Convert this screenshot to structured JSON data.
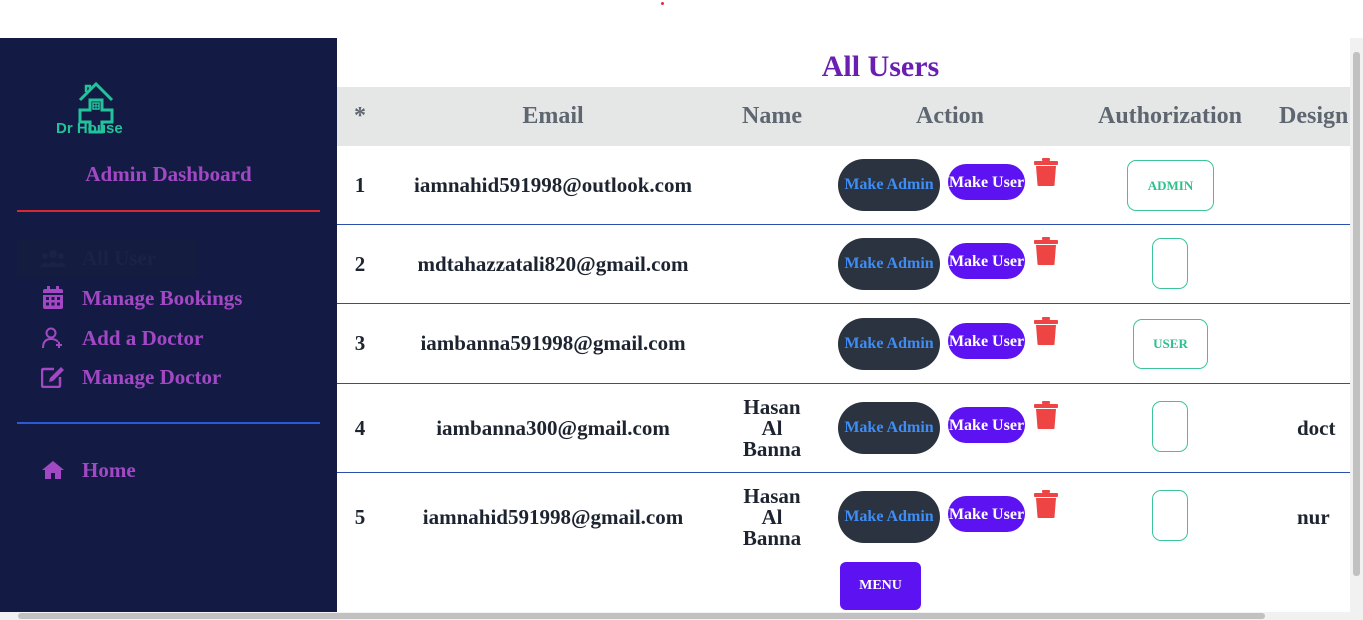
{
  "sidebar": {
    "logo_text": "Dr House",
    "dashboard_title": "Admin Dashboard",
    "nav": [
      {
        "label": "All User"
      },
      {
        "label": "Manage Bookings"
      },
      {
        "label": "Add a Doctor"
      },
      {
        "label": "Manage Doctor"
      }
    ],
    "home_label": "Home"
  },
  "main": {
    "title": "All Users",
    "headers": {
      "num": "*",
      "email": "Email",
      "name": "Name",
      "action": "Action",
      "authorization": "Authorization",
      "designation": "Design"
    },
    "make_admin": "Make Admin",
    "make_user": "Make User",
    "rows": [
      {
        "num": "1",
        "email": "iamnahid591998@outlook.com",
        "name": "",
        "role": "ADMIN",
        "designation": ""
      },
      {
        "num": "2",
        "email": "mdtahazzatali820@gmail.com",
        "name": "",
        "role": "",
        "designation": ""
      },
      {
        "num": "3",
        "email": "iambanna591998@gmail.com",
        "name": "",
        "role": "USER",
        "designation": ""
      },
      {
        "num": "4",
        "email": "iambanna300@gmail.com",
        "name": "Hasan Al Banna",
        "role": "",
        "designation": "doct"
      },
      {
        "num": "5",
        "email": "iamnahid591998@gmail.com",
        "name": "Hasan Al Banna",
        "role": "",
        "designation": "nur"
      }
    ],
    "menu_label": "MENU"
  },
  "colors": {
    "sidebar_bg": "#131b45",
    "accent_purple": "#a348c4",
    "title_purple": "#6a1fb0",
    "make_user_bg": "#5d12f2",
    "make_admin_bg": "#2b3340",
    "trash_red": "#ee4444",
    "auth_green": "#3cc49b"
  }
}
